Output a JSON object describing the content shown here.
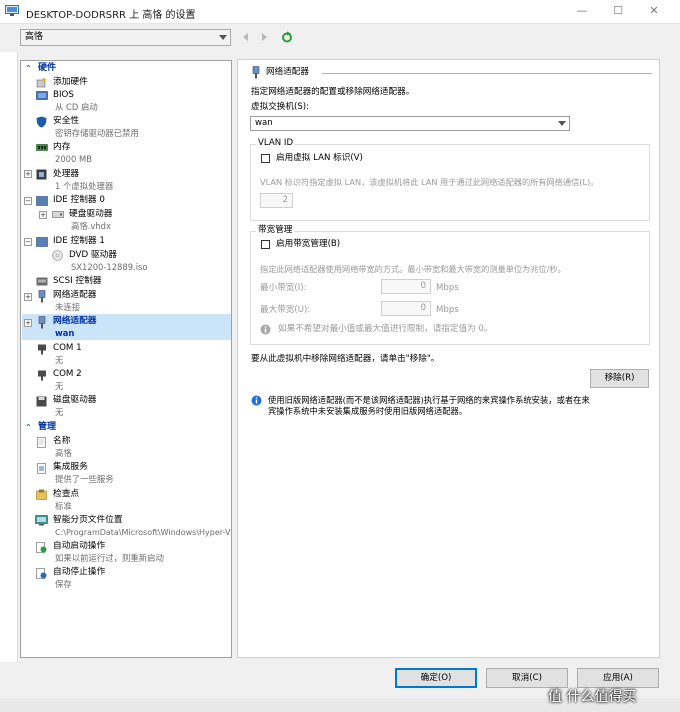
{
  "window": {
    "title": "DESKTOP-DODRSRR 上 高恪 的设置",
    "min": "—",
    "max": "☐",
    "close": "✕"
  },
  "toolbar": {
    "vm_name": "高恪"
  },
  "tree": {
    "hardware_header": "硬件",
    "add_hardware": "添加硬件",
    "bios": "BIOS",
    "bios_sub": "从 CD 启动",
    "security": "安全性",
    "security_sub": "密钥存储驱动器已禁用",
    "memory": "内存",
    "memory_sub": "2000 MB",
    "processor": "处理器",
    "processor_sub": "1 个虚拟处理器",
    "ide0": "IDE 控制器 0",
    "hdd": "硬盘驱动器",
    "hdd_sub": "高恪.vhdx",
    "ide1": "IDE 控制器 1",
    "dvd": "DVD 驱动器",
    "dvd_sub": "SX1200-12889.iso",
    "scsi": "SCSI 控制器",
    "nic1": "网络适配器",
    "nic1_sub": "未连接",
    "nic2": "网络适配器",
    "nic2_sub": "wan",
    "com1": "COM 1",
    "com1_sub": "无",
    "com2": "COM 2",
    "com2_sub": "无",
    "floppy": "磁盘驱动器",
    "floppy_sub": "无",
    "management_header": "管理",
    "name": "名称",
    "name_sub": "高恪",
    "integration": "集成服务",
    "integration_sub": "提供了一些服务",
    "checkpoints": "检查点",
    "checkpoints_sub": "标准",
    "paging": "智能分页文件位置",
    "paging_sub": "C:\\ProgramData\\Microsoft\\Windows\\Hyper-V",
    "autostart": "自动启动操作",
    "autostart_sub": "如果以前运行过，则重新启动",
    "autostop": "自动停止操作",
    "autostop_sub": "保存"
  },
  "panel": {
    "heading": "网络适配器",
    "desc": "指定网络适配器的配置或移除网络适配器。",
    "switch_label": "虚拟交换机(S):",
    "switch_value": "wan",
    "vlan_title": "VLAN ID",
    "vlan_check": "启用虚拟 LAN 标识(V)",
    "vlan_desc": "VLAN 标识符指定虚拟 LAN，该虚拟机将此 LAN 用于通过此网络适配器的所有网络通信(L)。",
    "vlan_value": "2",
    "bw_title": "带宽管理",
    "bw_check": "启用带宽管理(B)",
    "bw_desc": "指定此网络适配器使用网络带宽的方式。最小带宽和最大带宽的测量单位为兆位/秒。",
    "min_label": "最小带宽(I):",
    "min_value": "0",
    "max_label": "最大带宽(U):",
    "max_value": "0",
    "unit": "Mbps",
    "bw_note": "如果不希望对最小值或最大值进行限制，请指定值为 0。",
    "remove_text": "要从此虚拟机中移除网络适配器，请单击\"移除\"。",
    "remove_btn": "移除(R)",
    "info_text_1": "使用旧版网络适配器(而不是该网络适配器)执行基于网络的来宾操作系统安装，或者在来",
    "info_text_2": "宾操作系统中未安装集成服务时使用旧版网络适配器。"
  },
  "footer": {
    "ok": "确定(O)",
    "cancel": "取消(C)",
    "apply": "应用(A)"
  },
  "overlay": {
    "watermark": "值 什么值得买"
  },
  "colors": {
    "accent": "#0078d7",
    "selection": "#cce4f7",
    "header_blue": "#0033a0",
    "info_blue": "#1e6fd9"
  }
}
